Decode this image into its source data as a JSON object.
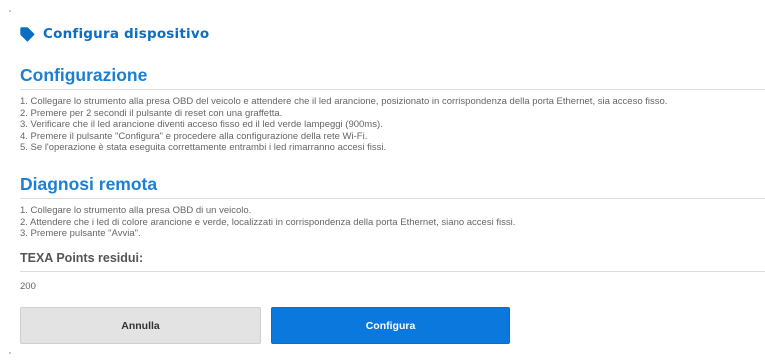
{
  "header": {
    "icon": "tag-icon",
    "title": "Configura dispositivo",
    "accent_color": "#0a6fc2"
  },
  "configurazione": {
    "title": "Configurazione",
    "steps": [
      "1. Collegare lo strumento alla presa OBD del veicolo e attendere che il led arancione, posizionato in corrispondenza della porta Ethernet, sia acceso fisso.",
      "2. Premere per 2 secondi il pulsante di reset con una graffetta.",
      "3. Verificare che il led arancione diventi acceso fisso ed il led verde lampeggi (900ms).",
      "4. Premere il pulsante \"Configura\" e procedere alla configurazione della rete Wi-Fi.",
      "5. Se l'operazione è stata eseguita correttamente entrambi i led rimarranno accesi fissi."
    ]
  },
  "diagnosi": {
    "title": "Diagnosi remota",
    "steps": [
      "1. Collegare lo strumento alla presa OBD di un veicolo.",
      "2. Attendere che i led di colore arancione e verde, localizzati in corrispondenza della porta Ethernet, siano accesi fissi.",
      "3. Premere pulsante \"Avvia\"."
    ]
  },
  "points": {
    "label": "TEXA Points residui:",
    "value": "200"
  },
  "buttons": {
    "cancel_label": "Annulla",
    "confirm_label": "Configura",
    "confirm_color": "#0a78dc"
  }
}
